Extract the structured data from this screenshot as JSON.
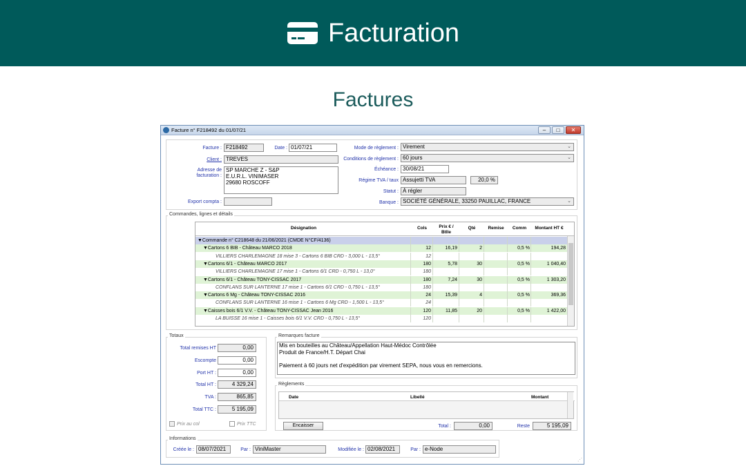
{
  "banner": {
    "title": "Facturation",
    "icon": "credit-card-icon"
  },
  "page": {
    "subtitle": "Factures"
  },
  "window": {
    "title": "Facture n° F218492 du 01/07/21",
    "buttons": [
      "–",
      "□",
      "✕"
    ]
  },
  "form": {
    "facture_label": "Facture :",
    "facture_value": "F218492",
    "date_label": "Date :",
    "date_value": "01/07/21",
    "client_label": "Client :",
    "client_value": "TREVES",
    "adresse_label1": "Adresse de",
    "adresse_label2": "facturation :",
    "adresse_lines": [
      "SP MARCHE Z - S&P",
      "E.U.R.L. VINIMASER",
      "29680 ROSCOFF"
    ],
    "export_label": "Export compta :",
    "export_value": "",
    "mode_label": "Mode de règlement :",
    "mode_value": "Virement",
    "conditions_label": "Conditions de règlement :",
    "conditions_value": "60 jours",
    "echeance_label": "Échéance :",
    "echeance_value": "30/08/21",
    "tva_label": "Régime TVA / taux",
    "tva_value": "Assujetti TVA",
    "tva_rate": "20,0 %",
    "statut_label": "Statut :",
    "statut_value": "À régler",
    "banque_label": "Banque :",
    "banque_value": "SOCIÉTÉ GÉNÉRALE, 33250 PAUILLAC, FRANCE"
  },
  "lines_section": {
    "title": "Commandes, lignes et détails",
    "headers": {
      "designation": "Désignation",
      "cols": "Cols",
      "prix": "Prix € /",
      "prix2": "Btlle",
      "qte": "Qté",
      "remise": "Remise",
      "comm": "Comm",
      "montant": "Montant HT €"
    },
    "rows": [
      {
        "kind": "cmd",
        "designation": "▼Commande n° C218648 du 21/06/2021 (CMDE N°CF/4136)",
        "cols": "",
        "prix": "",
        "qte": "",
        "remise": "",
        "comm": "",
        "montant": ""
      },
      {
        "kind": "art",
        "designation": "▼Cartons 6 BIB - Château MARCO 2018",
        "cols": "12",
        "prix": "16,19",
        "qte": "2",
        "remise": "",
        "comm": "0,5 %",
        "montant": "194,28"
      },
      {
        "kind": "lot",
        "designation": "VILLIERS CHARLEMAGNE 18 mise 3 - Cartons 6 BIB CRD - 3,000 L - 13,5°",
        "cols": "12",
        "prix": "",
        "qte": "",
        "remise": "",
        "comm": "",
        "montant": ""
      },
      {
        "kind": "art",
        "designation": "▼Cartons 6/1  - Château MARCO 2017",
        "cols": "180",
        "prix": "5,78",
        "qte": "30",
        "remise": "",
        "comm": "0,5 %",
        "montant": "1 040,40"
      },
      {
        "kind": "lot",
        "designation": "VILLIERS CHARLEMAGNE 17 mise 1 - Cartons 6/1  CRD - 0,750 L - 13,0°",
        "cols": "180",
        "prix": "",
        "qte": "",
        "remise": "",
        "comm": "",
        "montant": ""
      },
      {
        "kind": "art",
        "designation": "▼Cartons 6/1 - Château TONY-CISSAC 2017",
        "cols": "180",
        "prix": "7,24",
        "qte": "30",
        "remise": "",
        "comm": "0,5 %",
        "montant": "1 303,20"
      },
      {
        "kind": "lot",
        "designation": "CONFLANS SUR LANTERNE 17 mise 1 - Cartons 6/1 CRD - 0,750 L - 13,5°",
        "cols": "180",
        "prix": "",
        "qte": "",
        "remise": "",
        "comm": "",
        "montant": ""
      },
      {
        "kind": "art",
        "designation": "▼Cartons 6 Mg  - Château TONY-CISSAC 2016",
        "cols": "24",
        "prix": "15,39",
        "qte": "4",
        "remise": "",
        "comm": "0,5 %",
        "montant": "369,36"
      },
      {
        "kind": "lot",
        "designation": "CONFLANS SUR LANTERNE 16 mise 1 - Cartons 6 Mg  CRD - 1,500 L - 13,5°",
        "cols": "24",
        "prix": "",
        "qte": "",
        "remise": "",
        "comm": "",
        "montant": ""
      },
      {
        "kind": "art",
        "designation": "▼Caisses bois 6/1 V.V. - Château TONY-CISSAC Jean 2016",
        "cols": "120",
        "prix": "11,85",
        "qte": "20",
        "remise": "",
        "comm": "0,5 %",
        "montant": "1 422,00"
      },
      {
        "kind": "lot",
        "designation": "LA BUISSE 16 mise 1 - Caisses bois 6/1 V.V. CRD - 0,750 L - 13,5°",
        "cols": "120",
        "prix": "",
        "qte": "",
        "remise": "",
        "comm": "",
        "montant": ""
      }
    ]
  },
  "totaux": {
    "title": "Totaux",
    "remises_label": "Total remises HT",
    "remises_value": "0,00",
    "escompte_label": "Escompte",
    "escompte_value": "0,00",
    "port_label": "Port HT :",
    "port_value": "0,00",
    "ht_label": "Total HT :",
    "ht_value": "4 329,24",
    "tva_label": "TVA :",
    "tva_value": "865,85",
    "ttc_label": "Total TTC :",
    "ttc_value": "5 195,09",
    "prix_col_label": "Prix au col",
    "prix_ttc_label": "Prix TTC"
  },
  "remarques": {
    "title": "Remarques facture",
    "lines": [
      "Mis en bouteilles au Château/Appellation Haut-Médoc Contrôlée",
      "Produit de France/H.T. Départ Chai",
      "",
      "Paiement à 60 jours net d'expédition par virement SEPA, nous vous en remercions."
    ]
  },
  "reglements": {
    "title": "Règlements",
    "headers": {
      "date": "Date",
      "libelle": "Libellé",
      "montant": "Montant"
    },
    "encaisser_label": "Encaisser",
    "total_label": "Total :",
    "total_value": "0,00",
    "reste_label": "Reste",
    "reste_value": "5 195,09"
  },
  "informations": {
    "title": "Informations",
    "creee_label": "Créée le :",
    "creee_value": "08/07/2021",
    "par1_label": "Par :",
    "par1_value": "ViniMaster",
    "modifiee_label": "Modifiée le :",
    "modifiee_value": "02/08/2021",
    "par2_label": "Par :",
    "par2_value": "e-Node"
  },
  "colors": {
    "banner": "#005a5a",
    "subtitle": "#1b5b5b",
    "label_blue": "#2233aa",
    "cmd_row": "#c9d0ea",
    "art_row": "#dff3d6"
  }
}
